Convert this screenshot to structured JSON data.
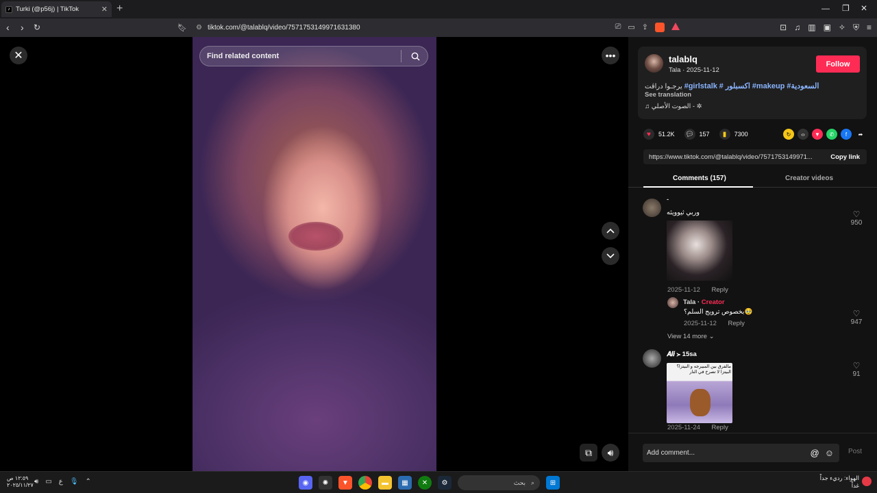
{
  "browser": {
    "tab_title": "Turki (@p56j) | TikTok",
    "url": "tiktok.com/@talablq/video/7571753149971631380"
  },
  "video": {
    "search_placeholder": "Find related content"
  },
  "post": {
    "username": "talablq",
    "nickname_date": "Tala · 2025-11-12",
    "follow_label": "Follow",
    "caption_text": "يرجـوا دراڤت",
    "hashtags": [
      "#girlstalk",
      "# اكسبلور",
      "#makeup",
      "#السعودية"
    ],
    "see_translation": "See translation",
    "music": "♫ الصوت الأصلي - ✲"
  },
  "stats": {
    "likes": "51.2K",
    "comments": "157",
    "saves": "7300"
  },
  "link": {
    "url": "https://www.tiktok.com/@talablq/video/7571753149971...",
    "copy_label": "Copy link"
  },
  "tabs": {
    "comments": "Comments (157)",
    "creator_videos": "Creator videos"
  },
  "comments": [
    {
      "name": "-",
      "text": "وربي ثيوويثه",
      "date": "2025-11-12",
      "reply": "Reply",
      "likes": "950"
    },
    {
      "name": "Tala",
      "creator_label": "Creator",
      "text": "بخصوص ترويج السلم؟🥹",
      "date": "2025-11-12",
      "reply": "Reply",
      "likes": "947"
    },
    {
      "view_more": "View 14 more"
    },
    {
      "name": "𝑨𝒍𝒊 ≻ 15sa",
      "sticker_text": "مالفرق بين المبيرجه و البيتزا؟ البيتزا لا تصرخ في النار",
      "date": "2025-11-24",
      "reply": "Reply",
      "likes": "91"
    }
  ],
  "comment_bar": {
    "placeholder": "Add comment...",
    "post_label": "Post"
  },
  "taskbar": {
    "time": "١٢:٥٩ ص",
    "date": "٢٠٢٥/١١/٢٧",
    "search_label": "بحث",
    "weather_line1": "الهواء: رديء جداً",
    "weather_line2": "غداً"
  },
  "colors": {
    "accent": "#fe2c55",
    "hashtag": "#8ab4ff",
    "panel_bg": "#121212"
  }
}
